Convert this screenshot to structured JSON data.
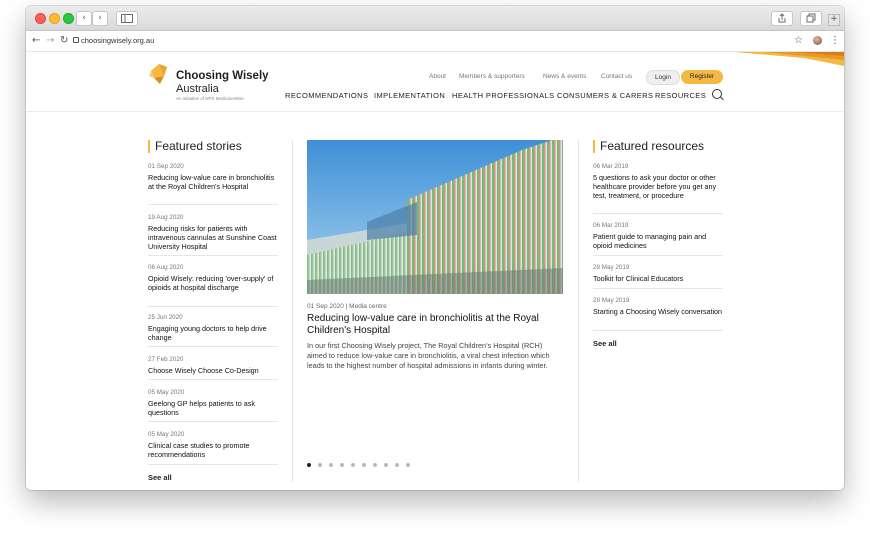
{
  "browser": {
    "url": "choosingwisely.org.au",
    "back_icon": "←",
    "forward_icon": "→",
    "reload_icon": "↻",
    "star_icon": "☆",
    "menu_icon": "⋮"
  },
  "brand": {
    "name": "Choosing Wisely",
    "country": "Australia",
    "tagline": "An initiative of NPS MedicineWise",
    "accent": "#f4b942"
  },
  "header": {
    "top_links": [
      "About",
      "Members & supporters",
      "News & events",
      "Contact us"
    ],
    "login": "Login",
    "register": "Register",
    "nav": [
      "RECOMMENDATIONS",
      "IMPLEMENTATION",
      "HEALTH PROFESSIONALS",
      "CONSUMERS & CARERS",
      "RESOURCES"
    ]
  },
  "featured_stories": {
    "title": "Featured stories",
    "items": [
      {
        "date": "01 Sep 2020",
        "title": "Reducing low-value care in bronchiolitis at the Royal Children's Hospital"
      },
      {
        "date": "19 Aug 2020",
        "title": "Reducing risks for patients with intravenous cannulas at Sunshine Coast University Hospital"
      },
      {
        "date": "06 Aug 2020",
        "title": "Opioid Wisely: reducing 'over-supply' of opioids at hospital discharge"
      },
      {
        "date": "25 Jun 2020",
        "title": "Engaging young doctors to help drive change"
      },
      {
        "date": "27 Feb 2020",
        "title": "Choose Wisely Choose Co-Design"
      },
      {
        "date": "05 May 2020",
        "title": "Geelong GP helps patients to ask questions"
      },
      {
        "date": "05 May 2020",
        "title": "Clinical case studies to promote recommendations"
      }
    ],
    "see_all": "See all"
  },
  "hero": {
    "meta": "01 Sep 2020 | Media centre",
    "title": "Reducing low-value care in bronchiolitis at the Royal Children's Hospital",
    "body": "In our first Choosing Wisely project, The Royal Children's Hospital (RCH) aimed to reduce low-value care in bronchiolitis, a viral chest infection which leads to the highest number of hospital admissions in infants during winter.",
    "slide_count": 10,
    "active_slide": 1
  },
  "featured_resources": {
    "title": "Featured resources",
    "items": [
      {
        "date": "06 Mar 2019",
        "title": "5 questions to ask your doctor or other healthcare provider before you get any test, treatment, or procedure"
      },
      {
        "date": "06 Mar 2019",
        "title": "Patient guide to managing pain and opioid medicines"
      },
      {
        "date": "28 May 2019",
        "title": "Toolkit for Clinical Educators"
      },
      {
        "date": "28 May 2019",
        "title": "Starting a Choosing Wisely conversation"
      }
    ],
    "see_all": "See all"
  }
}
